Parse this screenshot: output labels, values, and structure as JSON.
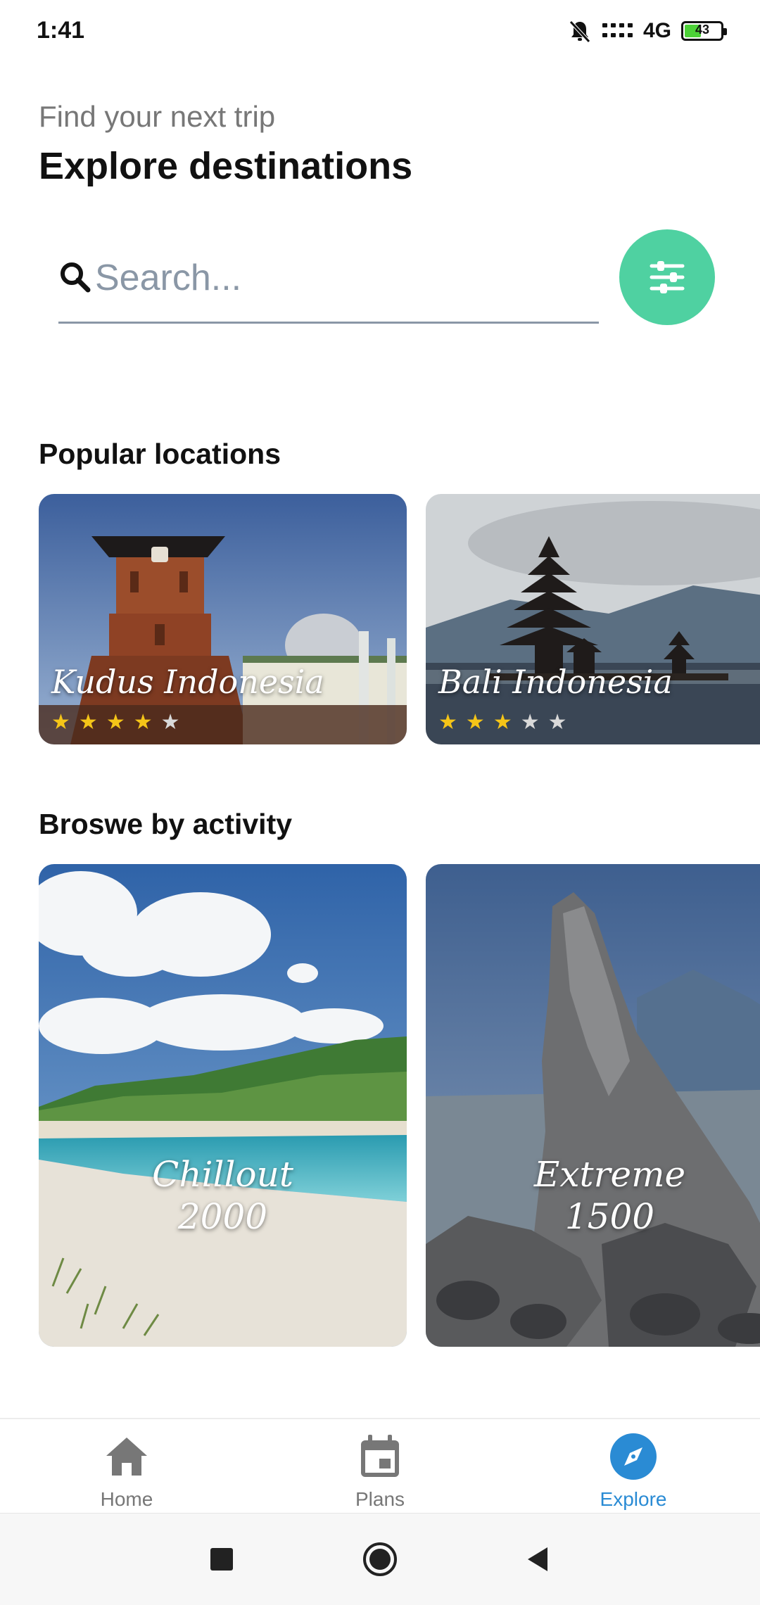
{
  "status_bar": {
    "time": "1:41",
    "network": "4G",
    "battery": "43"
  },
  "header": {
    "subtitle": "Find your next trip",
    "title": "Explore destinations"
  },
  "search": {
    "placeholder": "Search...",
    "value": ""
  },
  "popular": {
    "title": "Popular locations",
    "cards": [
      {
        "label": "Kudus Indonesia",
        "rating": 4,
        "max": 5
      },
      {
        "label": "Bali Indonesia",
        "rating": 3,
        "max": 5
      }
    ]
  },
  "activity": {
    "title": "Broswe by activity",
    "cards": [
      {
        "name": "Chillout",
        "count": "2000"
      },
      {
        "name": "Extreme",
        "count": "1500"
      }
    ]
  },
  "bottom_nav": {
    "items": [
      {
        "label": "Home",
        "icon": "home-icon"
      },
      {
        "label": "Plans",
        "icon": "calendar-icon"
      },
      {
        "label": "Explore",
        "icon": "compass-icon"
      }
    ],
    "active_color": "#2a8bd4"
  },
  "colors": {
    "accent": "#4fd1a1",
    "star": "#f5c518",
    "active": "#2a8bd4"
  }
}
